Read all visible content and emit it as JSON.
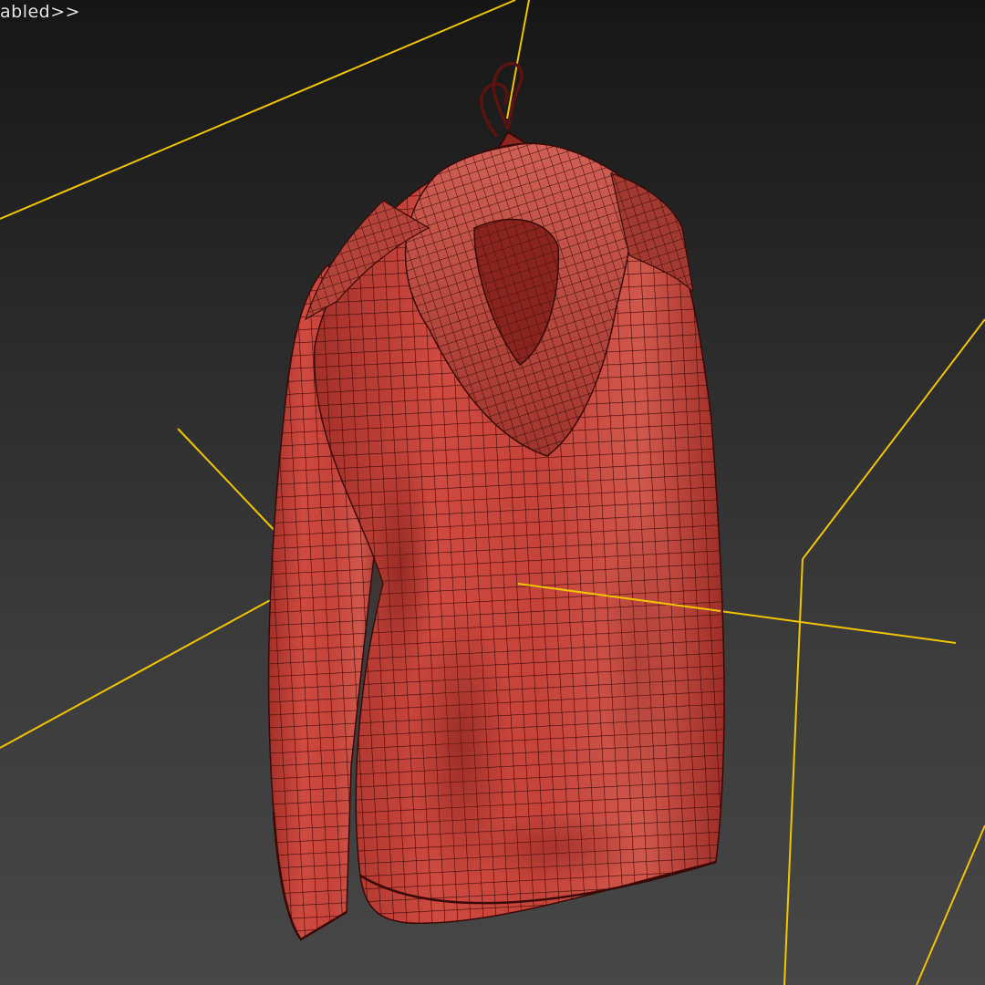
{
  "viewport": {
    "label": "abled>>",
    "shading": "smooth-plus-wireframe",
    "colors": {
      "bounding_box": "#f2c500",
      "mesh": "#c8423a",
      "wire": "#3a0906",
      "background_top": "#161616",
      "background_bottom": "#474747"
    }
  },
  "scene": {
    "object": "hoodie-on-hanger",
    "selection_bounds": "bounding-box-brackets",
    "gizmo": "pivot-axis"
  }
}
